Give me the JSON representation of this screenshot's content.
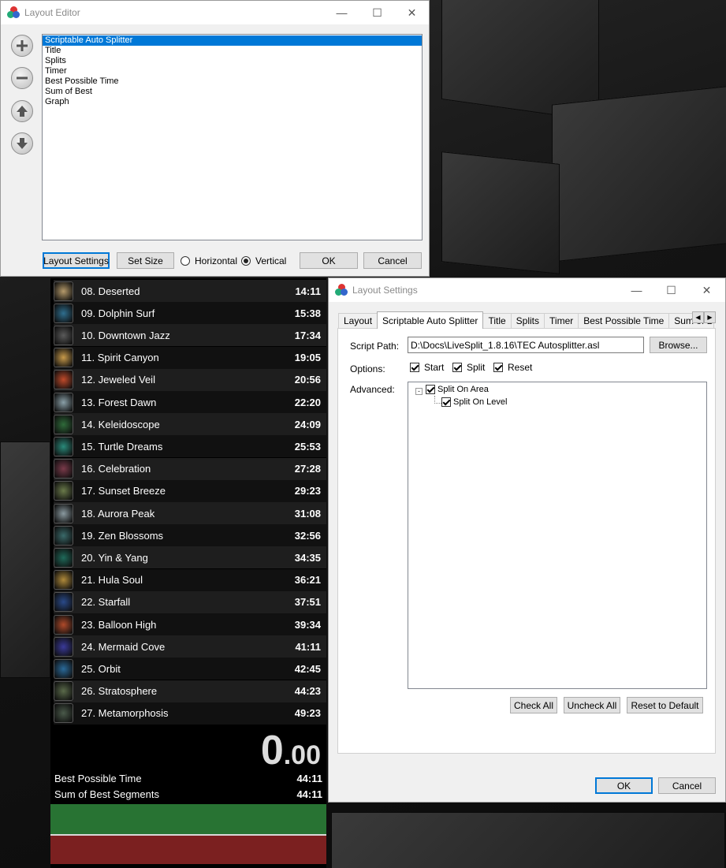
{
  "layout_editor": {
    "title": "Layout Editor",
    "components": [
      "Scriptable Auto Splitter",
      "Title",
      "Splits",
      "Timer",
      "Best Possible Time",
      "Sum of Best",
      "Graph"
    ],
    "selected_index": 0,
    "buttons": {
      "layout_settings": "Layout Settings",
      "set_size": "Set Size",
      "ok": "OK",
      "cancel": "Cancel"
    },
    "orientation": {
      "horizontal": "Horizontal",
      "vertical": "Vertical",
      "selected": "Vertical"
    }
  },
  "livesplit": {
    "splits": [
      {
        "name": "08. Deserted",
        "time": "14:11",
        "color": "#b59a6a"
      },
      {
        "name": "09. Dolphin Surf",
        "time": "15:38",
        "color": "#2f6f8f"
      },
      {
        "name": "10. Downtown Jazz",
        "time": "17:34",
        "color": "#5a5a5a"
      },
      {
        "name": "11. Spirit Canyon",
        "time": "19:05",
        "color": "#c89a4a"
      },
      {
        "name": "12. Jeweled Veil",
        "time": "20:56",
        "color": "#c04a2a"
      },
      {
        "name": "13. Forest Dawn",
        "time": "22:20",
        "color": "#8aa0a8"
      },
      {
        "name": "14. Keleidoscope",
        "time": "24:09",
        "color": "#2f6b3a"
      },
      {
        "name": "15. Turtle Dreams",
        "time": "25:53",
        "color": "#2a8a7a"
      },
      {
        "name": "16. Celebration",
        "time": "27:28",
        "color": "#7a3a4a"
      },
      {
        "name": "17. Sunset Breeze",
        "time": "29:23",
        "color": "#6a7a4a"
      },
      {
        "name": "18. Aurora Peak",
        "time": "31:08",
        "color": "#8a9aa0"
      },
      {
        "name": "19. Zen Blossoms",
        "time": "32:56",
        "color": "#3a6a6a"
      },
      {
        "name": "20. Yin & Yang",
        "time": "34:35",
        "color": "#1f6a5a"
      },
      {
        "name": "21. Hula Soul",
        "time": "36:21",
        "color": "#b08a3a"
      },
      {
        "name": "22. Starfall",
        "time": "37:51",
        "color": "#2a4a8a"
      },
      {
        "name": "23. Balloon High",
        "time": "39:34",
        "color": "#b04a2a"
      },
      {
        "name": "24. Mermaid Cove",
        "time": "41:11",
        "color": "#3a3a9a"
      },
      {
        "name": "25. Orbit",
        "time": "42:45",
        "color": "#2a6a9a"
      },
      {
        "name": "26. Stratosphere",
        "time": "44:23",
        "color": "#5a6a4a"
      },
      {
        "name": "27. Metamorphosis",
        "time": "49:23",
        "color": "#4a5a4a"
      }
    ],
    "timer_main": "0",
    "timer_fraction": ".00",
    "best_possible_label": "Best Possible Time",
    "best_possible_value": "44:11",
    "sum_of_best_label": "Sum of Best Segments",
    "sum_of_best_value": "44:11"
  },
  "layout_settings": {
    "title": "Layout Settings",
    "tabs": [
      "Layout",
      "Scriptable Auto Splitter",
      "Title",
      "Splits",
      "Timer",
      "Best Possible Time",
      "Sum of Bes"
    ],
    "selected_tab": 1,
    "script_path_label": "Script Path:",
    "script_path_value": "D:\\Docs\\LiveSplit_1.8.16\\TEC Autosplitter.asl",
    "browse": "Browse...",
    "options_label": "Options:",
    "options": [
      "Start",
      "Split",
      "Reset"
    ],
    "advanced_label": "Advanced:",
    "tree": {
      "parent": "Split On Area",
      "child": "Split On Level"
    },
    "check_all": "Check All",
    "uncheck_all": "Uncheck All",
    "reset_default": "Reset to Default",
    "ok": "OK",
    "cancel": "Cancel"
  },
  "colors": {
    "accent": "#0078d7",
    "graph_ahead": "#287333",
    "graph_behind": "#7b2020"
  }
}
